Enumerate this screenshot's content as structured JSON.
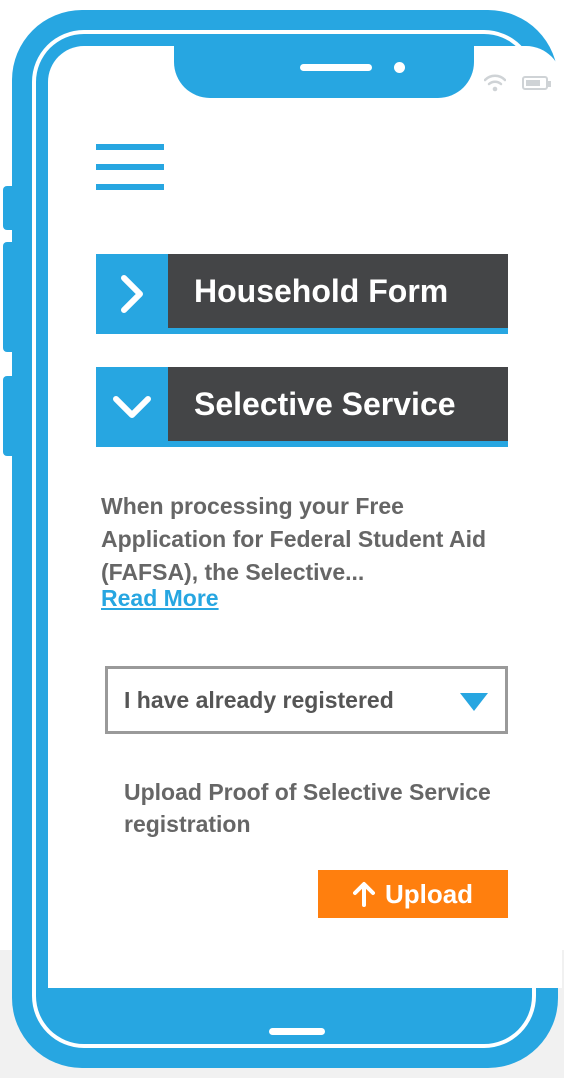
{
  "colors": {
    "accent": "#27a6e1",
    "header_dark": "#444547",
    "body_text": "#666666",
    "upload_orange": "#ff7f0e"
  },
  "status_bar": {
    "icons": [
      "wifi-icon",
      "battery-icon"
    ]
  },
  "menu": {
    "icon": "hamburger-menu-icon"
  },
  "sections": [
    {
      "title": "Household Form",
      "state": "collapsed",
      "icon": "chevron-right-icon"
    },
    {
      "title": "Selective Service",
      "state": "expanded",
      "icon": "chevron-down-icon"
    }
  ],
  "selective_service": {
    "description": "When processing your Free Application for Federal Student Aid (FAFSA), the Selective...",
    "read_more": "Read More",
    "dropdown": {
      "selected": "I have already registered",
      "icon": "triangle-down-icon"
    },
    "upload_label": "Upload Proof of Selective Service registration",
    "upload_button": {
      "label": "Upload",
      "icon": "arrow-up-icon"
    }
  }
}
